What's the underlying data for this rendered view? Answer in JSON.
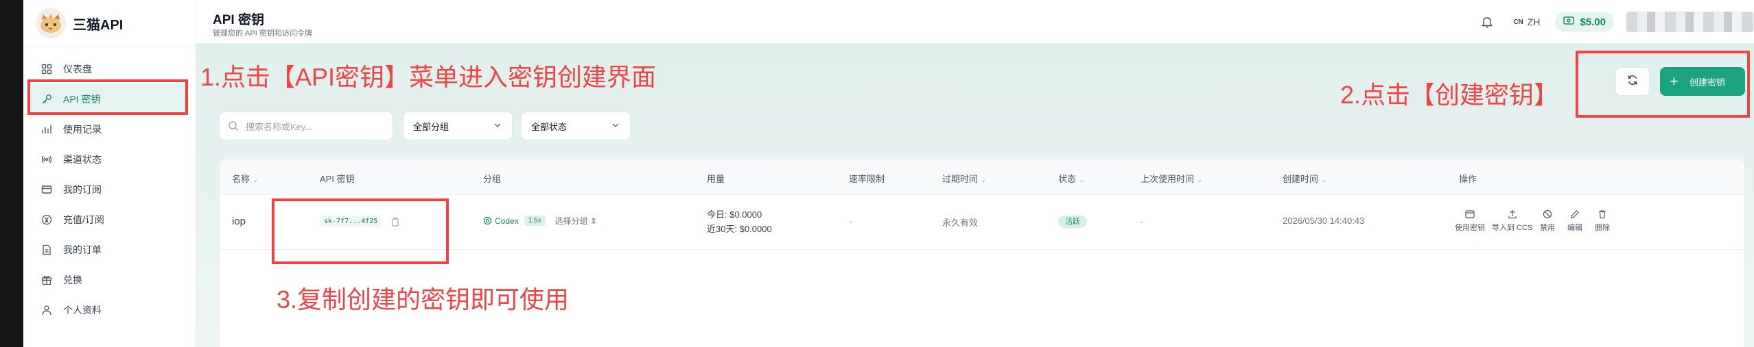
{
  "brand": {
    "name": "三猫API"
  },
  "sidebar": {
    "items": [
      {
        "label": "仪表盘",
        "icon": "dashboard-icon"
      },
      {
        "label": "API 密钥",
        "icon": "key-icon",
        "active": true
      },
      {
        "label": "使用记录",
        "icon": "chart-icon"
      },
      {
        "label": "渠道状态",
        "icon": "broadcast-icon"
      },
      {
        "label": "我的订阅",
        "icon": "card-icon"
      },
      {
        "label": "充值/订阅",
        "icon": "yen-icon"
      },
      {
        "label": "我的订单",
        "icon": "order-icon"
      },
      {
        "label": "兑换",
        "icon": "gift-icon"
      },
      {
        "label": "个人资料",
        "icon": "user-icon"
      }
    ]
  },
  "header": {
    "title": "API 密钥",
    "subtitle": "管理您的 API 密钥和访问令牌",
    "lang_flag": "CN",
    "lang": "ZH",
    "balance": "$5.00"
  },
  "annotations": {
    "step1": "1.点击【API密钥】菜单进入密钥创建界面",
    "step2": "2.点击【创建密钥】",
    "step3": "3.复制创建的密钥即可使用"
  },
  "filters": {
    "search_placeholder": "搜索名称或Key...",
    "group_select": "全部分组",
    "status_select": "全部状态"
  },
  "toolbar": {
    "create_label": "创建密钥"
  },
  "table": {
    "columns": [
      "名称",
      "API 密钥",
      "分组",
      "用量",
      "速率限制",
      "过期时间",
      "状态",
      "上次使用时间",
      "创建时间",
      "操作"
    ],
    "rows": [
      {
        "name": "iop",
        "key": "sk-7f7...4f25",
        "group": "Codex",
        "group_mult": "1.5x",
        "group_select": "选择分组",
        "usage_today": "今日: $0.0000",
        "usage_30d": "近30天: $0.0000",
        "rate_limit": "-",
        "expires": "永久有效",
        "status": "活跃",
        "last_used": "-",
        "created": "2026/05/30 14:40:43"
      }
    ],
    "actions": [
      "使用密钥",
      "导入到 CCS",
      "禁用",
      "编辑",
      "删除"
    ]
  },
  "colors": {
    "accent": "#1aa37f",
    "annotation": "#ef4444"
  }
}
